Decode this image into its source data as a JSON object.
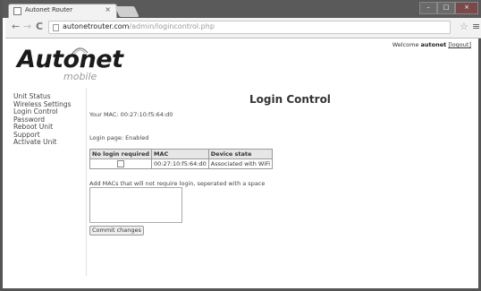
{
  "browser": {
    "tab_title": "Autonet Router",
    "tab_close": "×",
    "url_domain": "autonetrouter.com",
    "url_path": "/admin/logincontrol.php",
    "back_icon": "←",
    "forward_icon": "→",
    "reload_icon": "C",
    "star_icon": "☆",
    "menu_icon": "≡"
  },
  "header": {
    "welcome_prefix": "Welcome ",
    "username": "autonet",
    "logout": "[logout]"
  },
  "logo": {
    "name": "Autonet",
    "sub": "mobile"
  },
  "sidebar": {
    "items": [
      {
        "label": "Unit Status"
      },
      {
        "label": "Wireless Settings"
      },
      {
        "label": "Login Control"
      },
      {
        "label": "Password"
      },
      {
        "label": "Reboot Unit"
      },
      {
        "label": "Support"
      },
      {
        "label": "Activate Unit"
      }
    ]
  },
  "main": {
    "title": "Login Control",
    "your_mac": "Your MAC: 00:27:10:f5:64:d0",
    "login_page": "Login page: Enabled",
    "table": {
      "headers": [
        "No login required",
        "MAC",
        "Device state"
      ],
      "rows": [
        {
          "checked": false,
          "mac": "00:27:10:f5:64:d0",
          "state": "Associated with WiFi"
        }
      ]
    },
    "add_label": "Add MACs that will not require login, seperated with a space",
    "textarea_value": "",
    "commit_label": "Commit changes"
  }
}
